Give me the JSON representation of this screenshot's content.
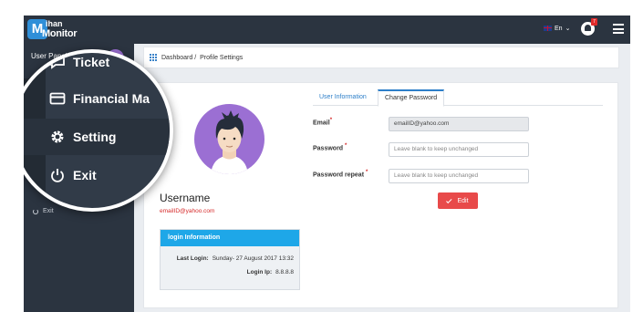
{
  "topbar": {
    "logo_top": "ihan",
    "logo_bottom": "Monitor",
    "logo_mark": "M",
    "language": "En",
    "language_caret": "⌄",
    "notification_count": "7"
  },
  "sidebar": {
    "panel_title": "User Panel",
    "exit_label": "Exit"
  },
  "magnifier": {
    "items": [
      {
        "label": "Ticket",
        "icon": "chat-icon"
      },
      {
        "label": "Financial Ma",
        "icon": "card-icon"
      },
      {
        "label": "Setting",
        "icon": "gear-icon"
      },
      {
        "label": "Exit",
        "icon": "power-icon"
      }
    ]
  },
  "breadcrumb": {
    "home": "Dashboard /",
    "current": "Profile Settings"
  },
  "profile": {
    "username": "Username",
    "email": "emailID@yahoo.com",
    "login_info": {
      "title": "login Information",
      "last_login_label": "Last Login:",
      "last_login_value": "Sunday- 27 August 2017 13:32",
      "login_ip_label": "Login Ip:",
      "login_ip_value": "8.8.8.8"
    }
  },
  "tabs": {
    "user_info": "User Information",
    "change_password": "Change Password"
  },
  "form": {
    "email_label": "Email",
    "email_value": "emailID@yahoo.com",
    "password_label": "Password",
    "password_placeholder": "Leave blank to keep unchanged",
    "password_repeat_label": "Password repeat",
    "password_repeat_placeholder": "Leave blank to keep unchanged",
    "required_mark": "*",
    "edit_button": "Edit"
  },
  "colors": {
    "sidebar": "#2b3440",
    "accent": "#1ea7e8",
    "danger": "#e84a4a",
    "avatar": "#9b6fd3"
  }
}
